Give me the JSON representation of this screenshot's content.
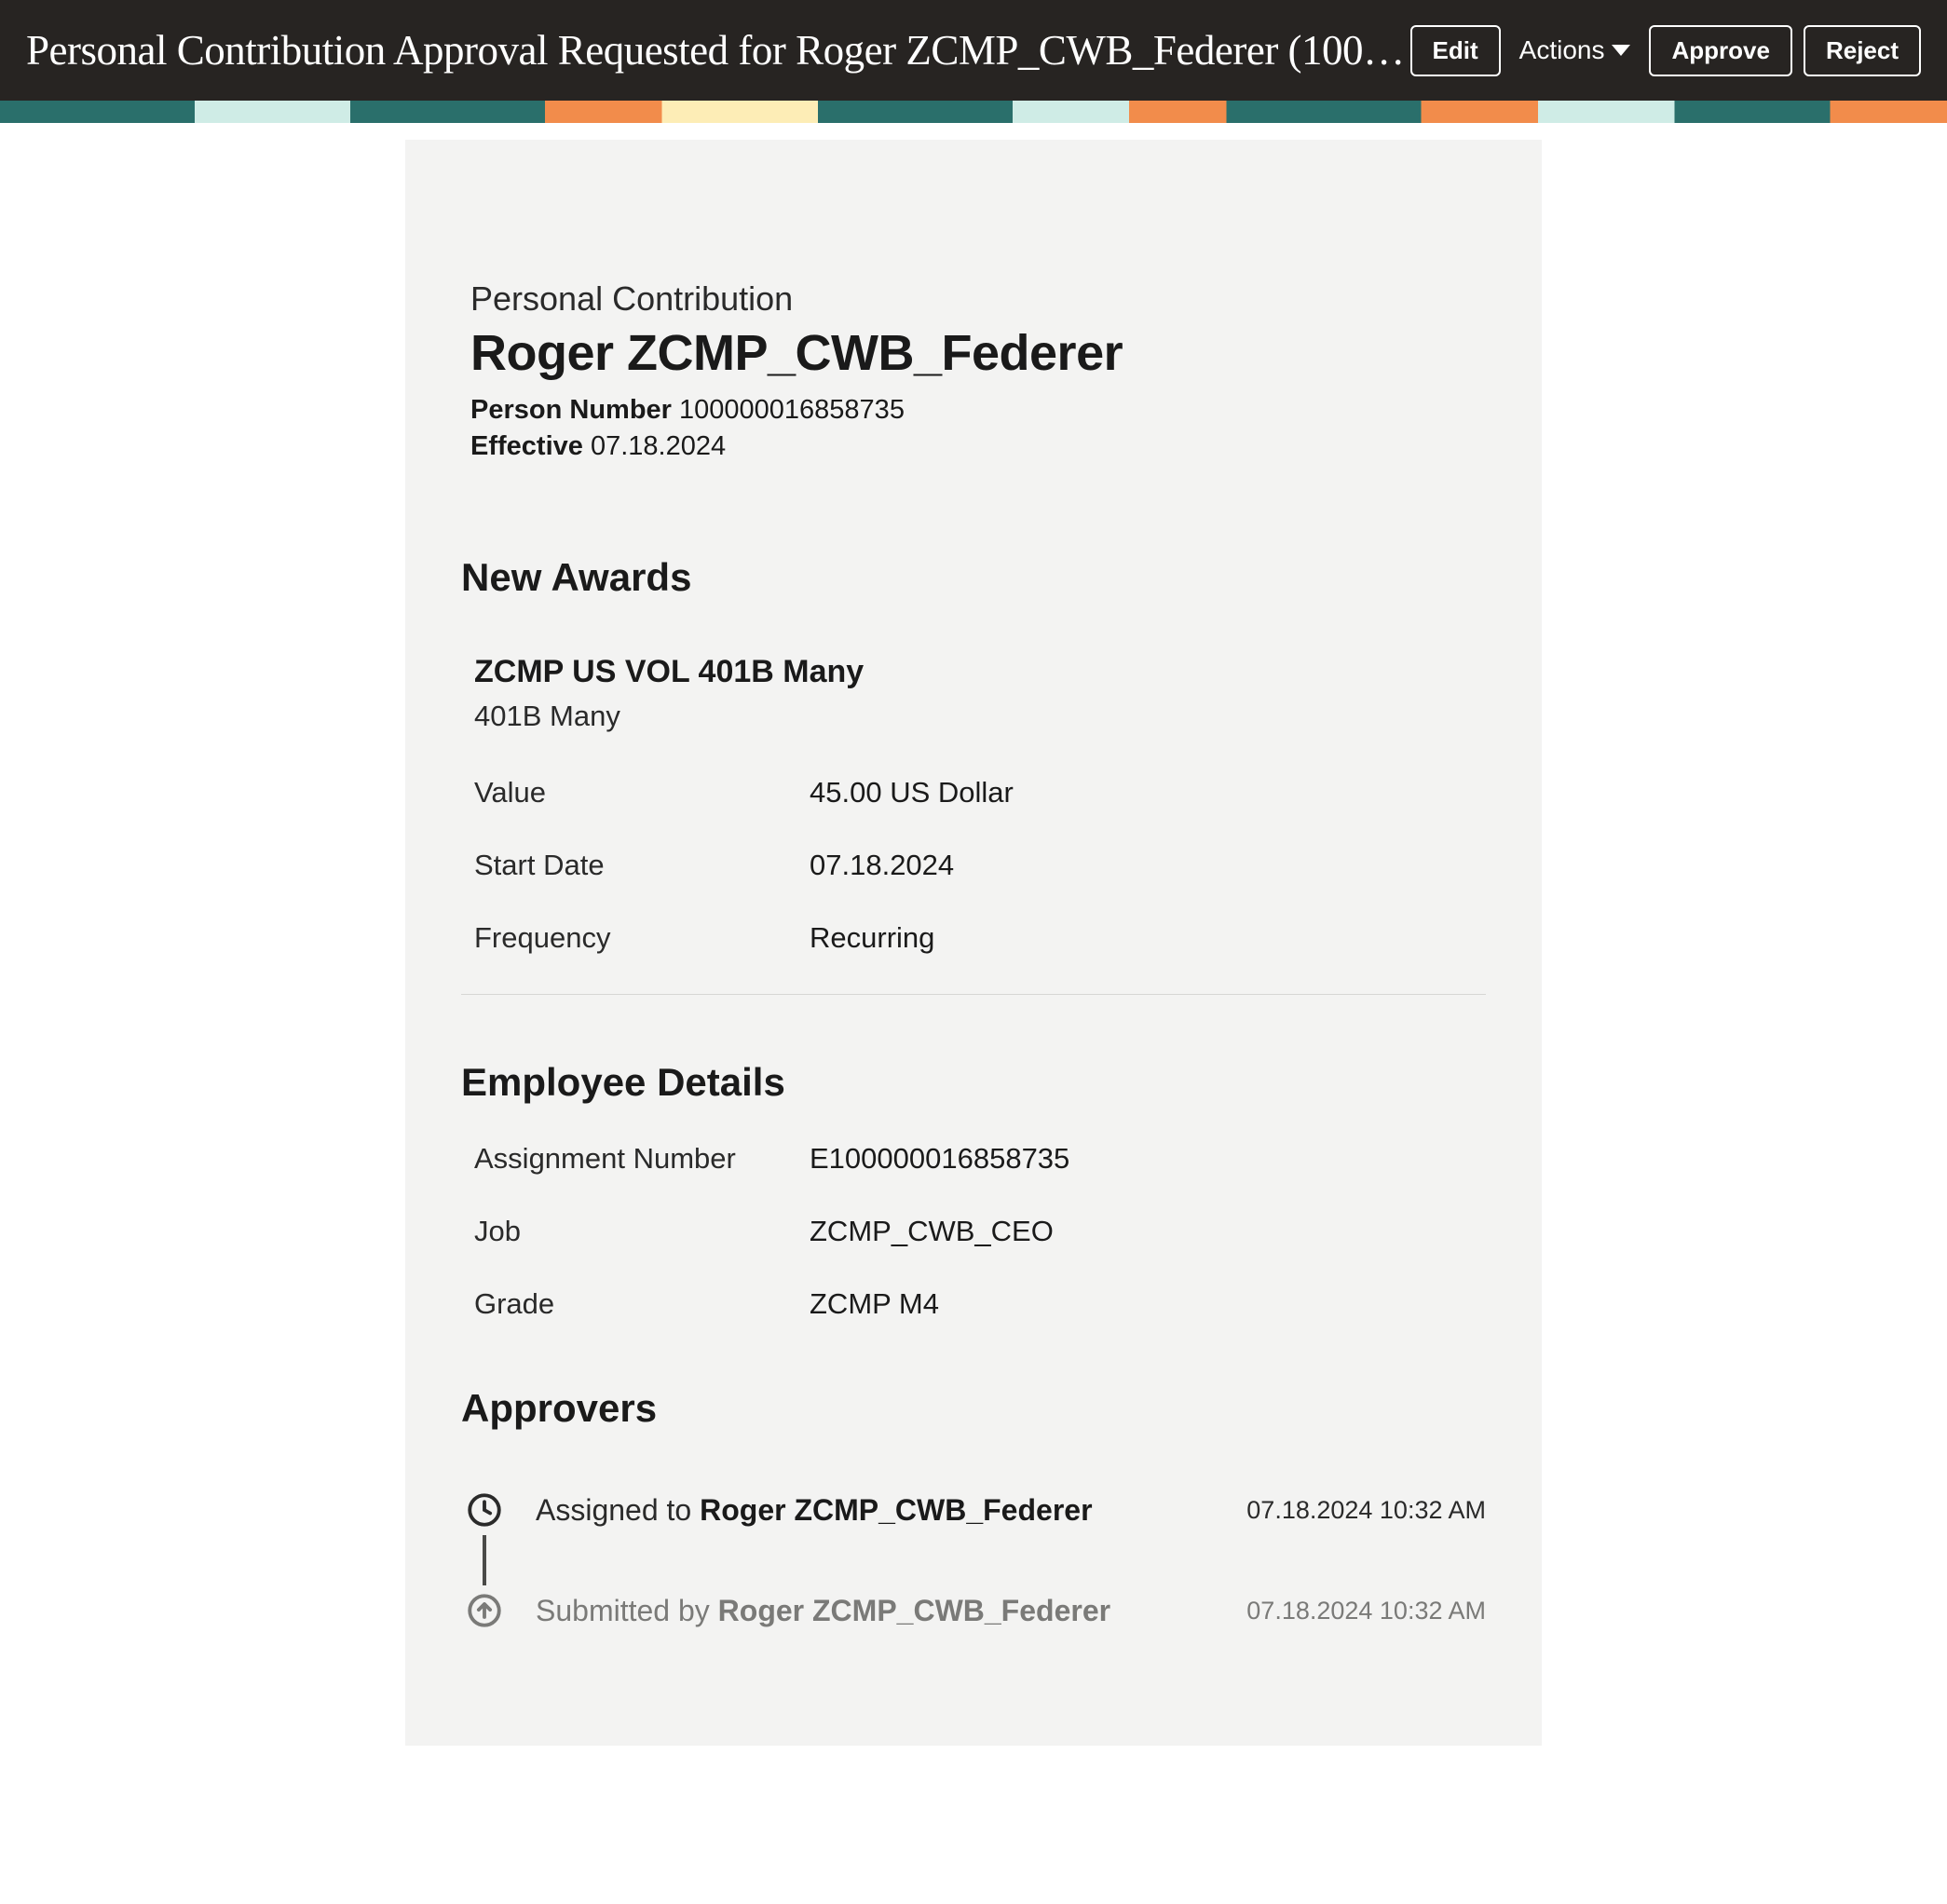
{
  "header": {
    "title": "Personal Contribution Approval Requested for Roger ZCMP_CWB_Federer (1000…",
    "edit": "Edit",
    "actions": "Actions",
    "approve": "Approve",
    "reject": "Reject"
  },
  "intro": {
    "subhead": "Personal Contribution",
    "person_name": "Roger ZCMP_CWB_Federer",
    "person_number_label": "Person Number",
    "person_number": "100000016858735",
    "effective_label": "Effective",
    "effective": "07.18.2024"
  },
  "awards": {
    "title": "New Awards",
    "item": {
      "name": "ZCMP US VOL 401B Many",
      "sub": "401B Many",
      "rows": [
        {
          "k": "Value",
          "v": "45.00 US Dollar"
        },
        {
          "k": "Start Date",
          "v": "07.18.2024"
        },
        {
          "k": "Frequency",
          "v": "Recurring"
        }
      ]
    }
  },
  "employee": {
    "title": "Employee Details",
    "rows": [
      {
        "k": "Assignment Number",
        "v": "E100000016858735"
      },
      {
        "k": "Job",
        "v": "ZCMP_CWB_CEO"
      },
      {
        "k": "Grade",
        "v": "ZCMP M4"
      }
    ]
  },
  "approvers": {
    "title": "Approvers",
    "assigned_prefix": "Assigned to ",
    "assigned_name": "Roger ZCMP_CWB_Federer",
    "assigned_time": "07.18.2024 10:32 AM",
    "submitted_prefix": "Submitted by ",
    "submitted_name": "Roger ZCMP_CWB_Federer",
    "submitted_time": "07.18.2024 10:32 AM"
  }
}
